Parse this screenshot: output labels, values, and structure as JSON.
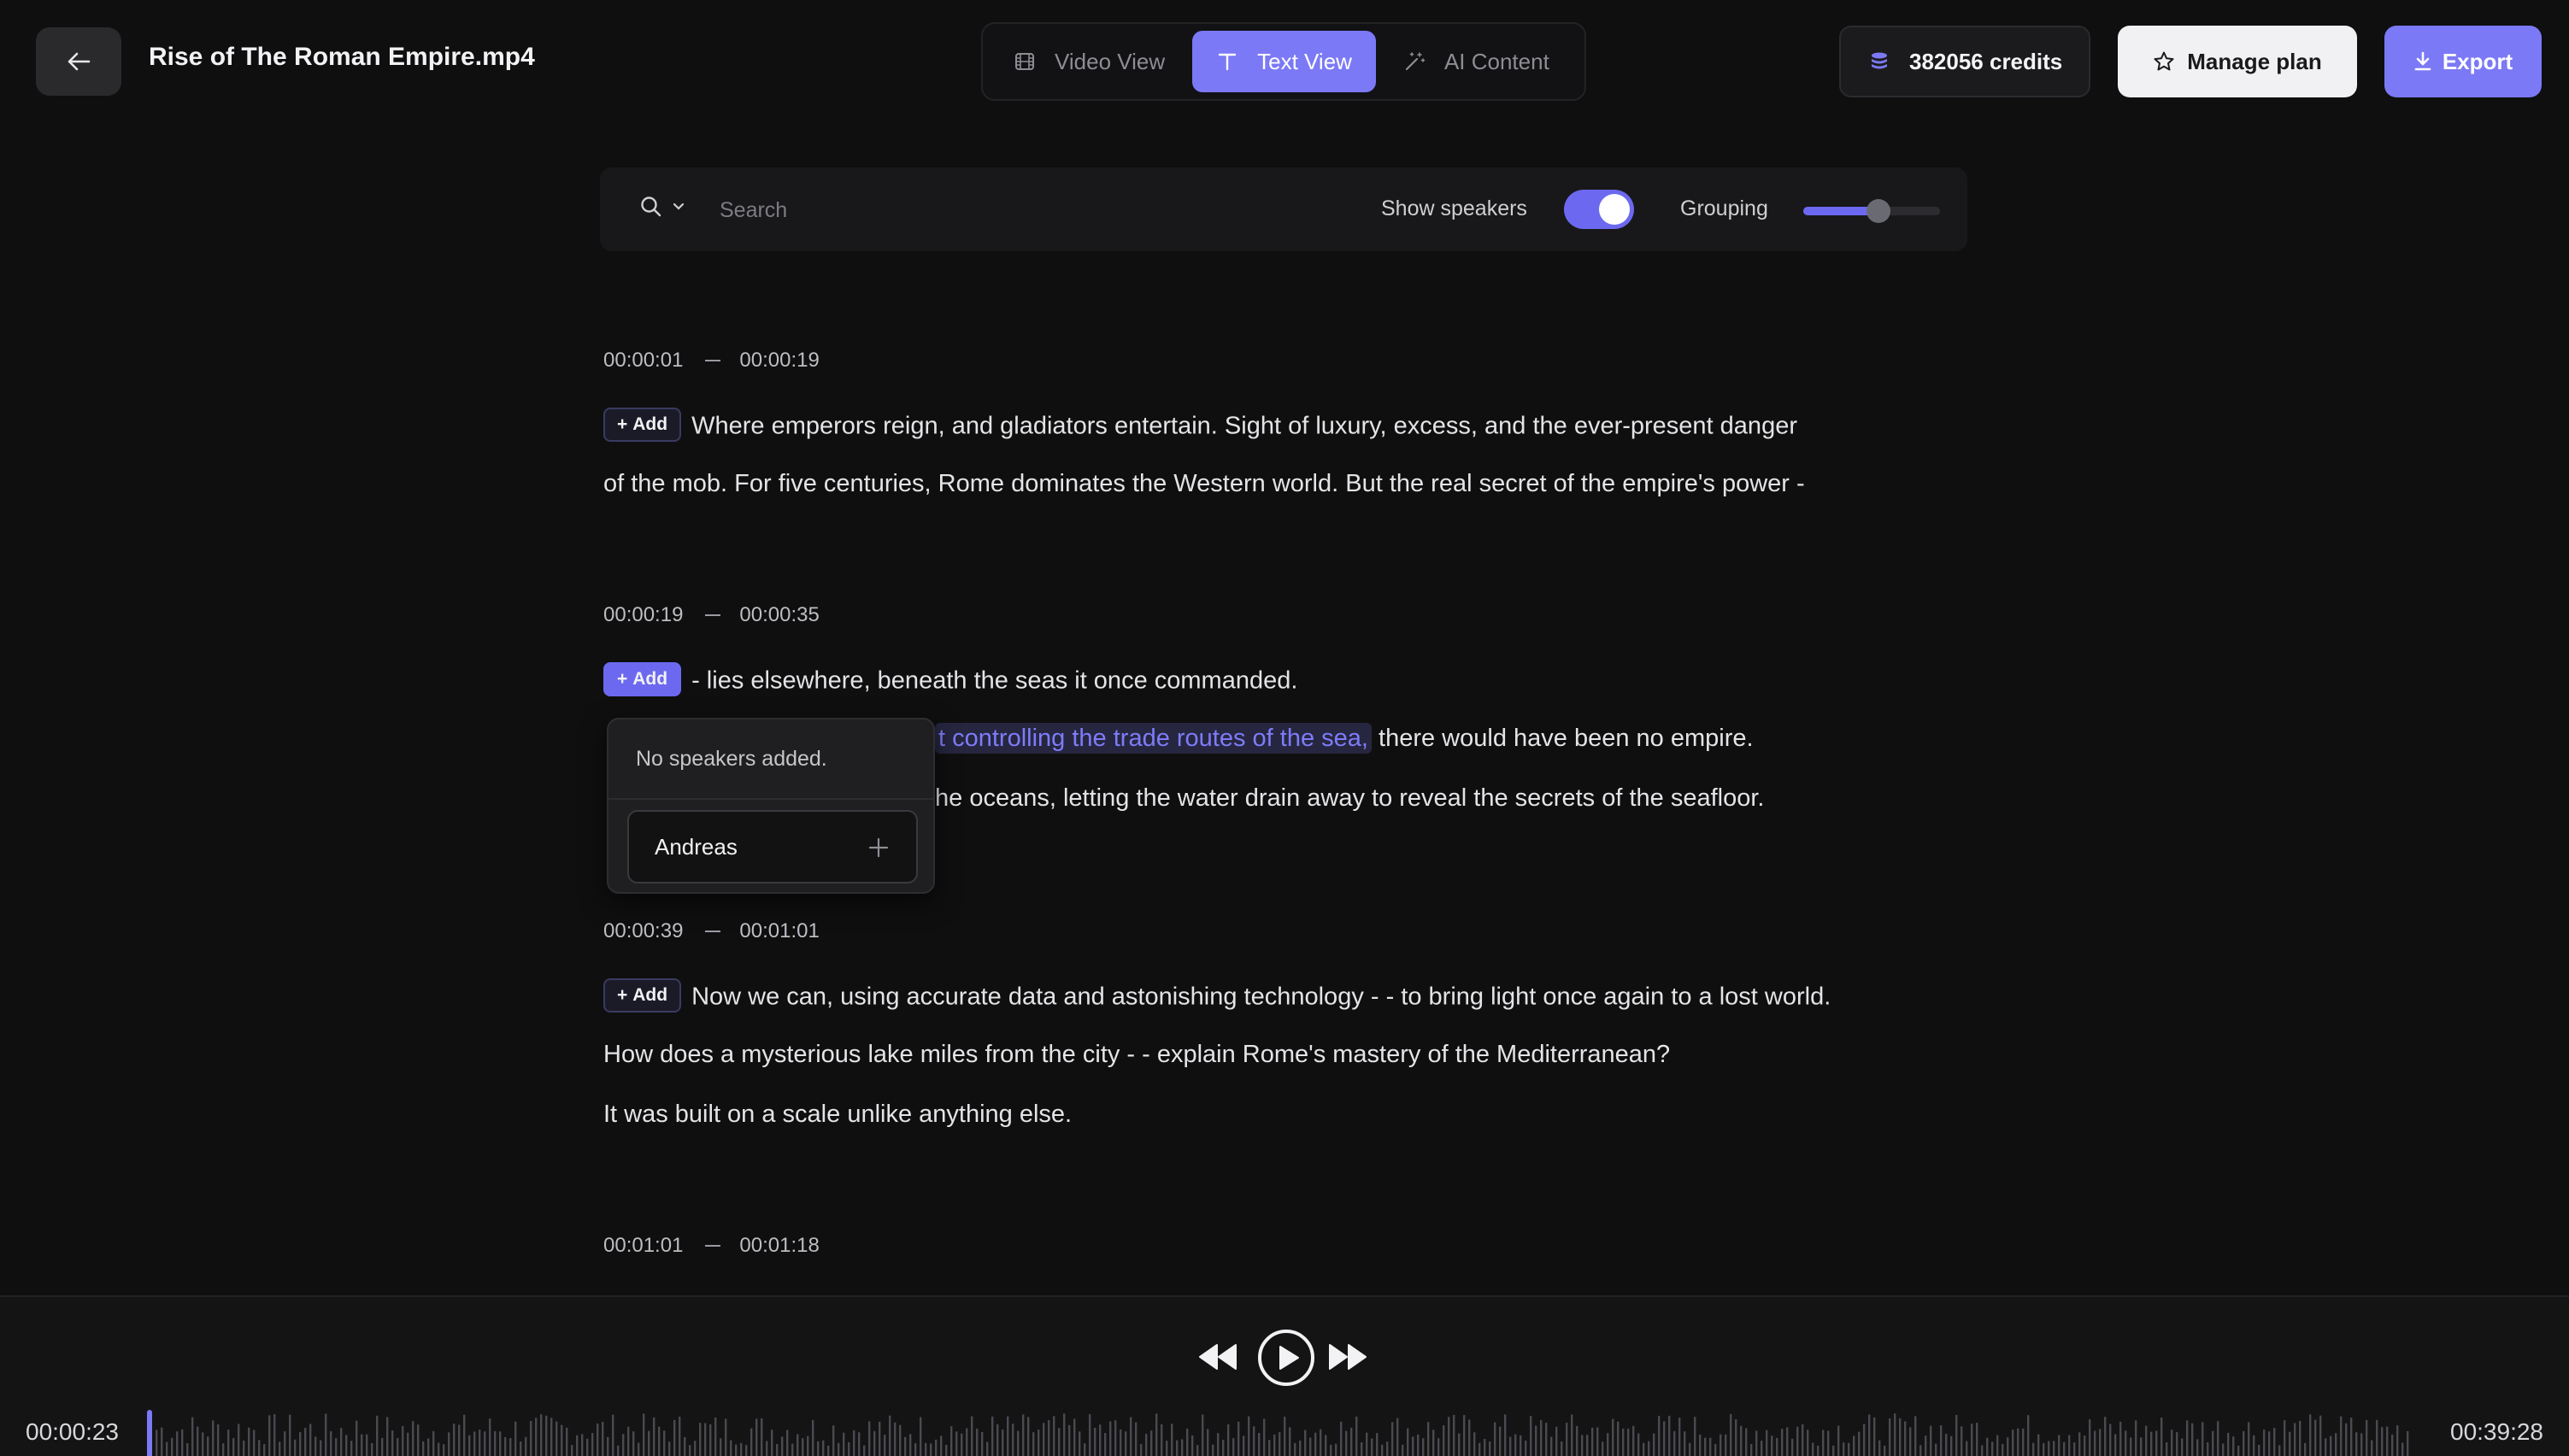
{
  "header": {
    "file_title": "Rise of The Roman Empire.mp4",
    "tabs": [
      {
        "label": "Video View",
        "icon": "film-icon",
        "active": false
      },
      {
        "label": "Text View",
        "icon": "text-icon",
        "active": true
      },
      {
        "label": "AI Content",
        "icon": "magic-wand-icon",
        "active": false
      }
    ],
    "credits": "382056 credits",
    "manage_plan": "Manage plan",
    "export": "Export"
  },
  "toolbar": {
    "search_placeholder": "Search",
    "show_speakers_label": "Show speakers",
    "show_speakers_on": true,
    "grouping_label": "Grouping",
    "grouping_level": 0.55
  },
  "segments": [
    {
      "start": "00:00:01",
      "end": "00:00:19",
      "add_label": "Add",
      "lines": [
        "Where emperors reign, and gladiators entertain. Sight of luxury, excess, and the ever-present danger",
        "of the mob. For five centuries, Rome dominates the Western world. But the real secret of the empire's power -"
      ]
    },
    {
      "start": "00:00:19",
      "end": "00:00:35",
      "add_label": "Add",
      "lines": [
        "- lies elsewhere, beneath the seas it once commanded."
      ],
      "highlight_text": "t controlling the trade routes of the sea,",
      "highlight_after": " there would have been no empire.",
      "line3_visible": "he oceans, letting the water drain away to reveal the secrets of the seafloor."
    },
    {
      "start": "00:00:39",
      "end": "00:01:01",
      "add_label": "Add",
      "lines": [
        "Now we can, using accurate data and astonishing technology - - to bring light once again to a lost world.",
        "How does a mysterious lake miles from the city - - explain Rome's mastery of the Mediterranean?",
        "It was built on a scale unlike anything else."
      ]
    },
    {
      "start": "00:01:01",
      "end": "00:01:18"
    }
  ],
  "speaker_popover": {
    "empty_text": "No speakers added.",
    "input_value": "Andreas"
  },
  "player": {
    "current_time": "00:00:23",
    "total_time": "00:39:28"
  },
  "colors": {
    "accent": "#7c79f6",
    "background": "#0f0f10"
  }
}
